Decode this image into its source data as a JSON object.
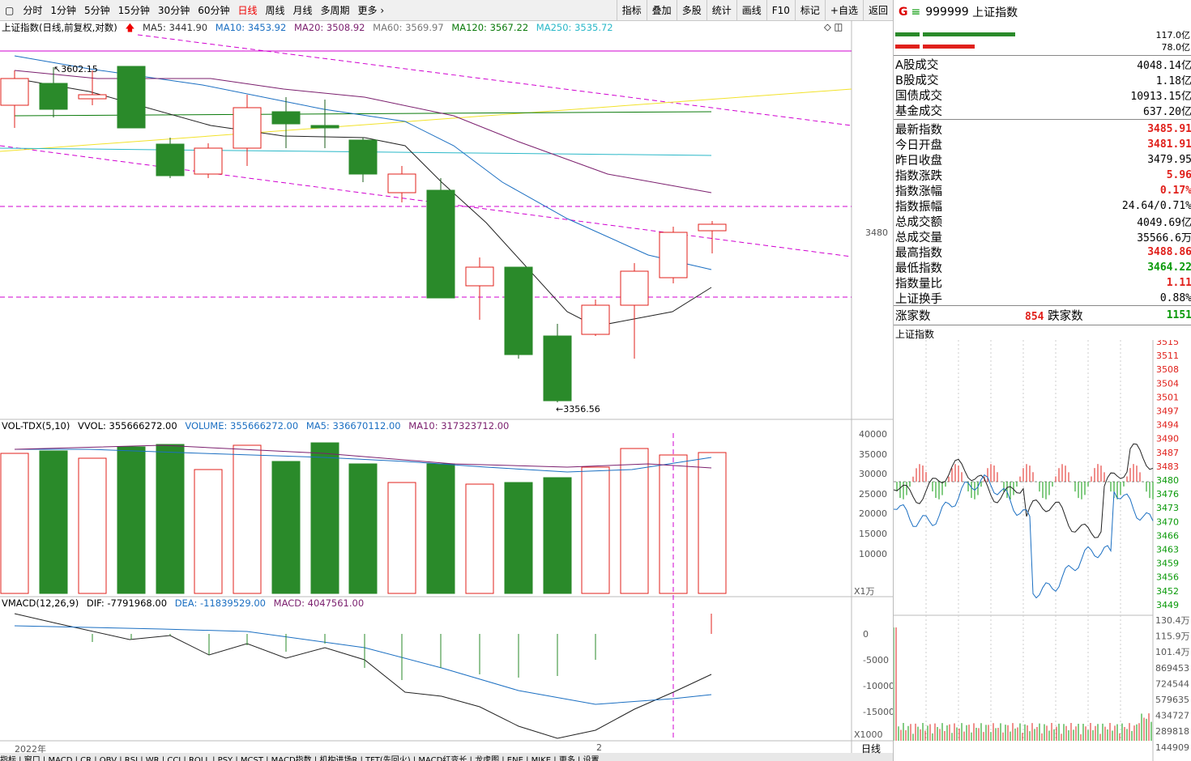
{
  "toolbar": {
    "periods": [
      "分时",
      "1分钟",
      "5分钟",
      "15分钟",
      "30分钟",
      "60分钟",
      "日线",
      "周线",
      "月线",
      "多周期",
      "更多"
    ],
    "active_index": 6,
    "right_buttons": [
      "指标",
      "叠加",
      "多股",
      "统计",
      "画线",
      "F10",
      "标记",
      "+自选",
      "返回"
    ]
  },
  "main_legend": {
    "name": "上证指数(日线,前复权,对数)",
    "ma5": "MA5: 3441.90",
    "ma10": "MA10: 3453.92",
    "ma20": "MA20: 3508.92",
    "ma60": "MA60: 3569.97",
    "ma120": "MA120: 3567.22",
    "ma250": "MA250: 3535.72"
  },
  "annotations": {
    "high": "3602.15",
    "low": "3356.56",
    "price_label": "3480",
    "year": "2022年",
    "month": "2"
  },
  "vol_legend": {
    "name": "VOL-TDX(5,10)",
    "vvol": "VVOL: 355666272.00",
    "volume": "VOLUME: 355666272.00",
    "ma5": "MA5: 336670112.00",
    "ma10": "MA10: 317323712.00"
  },
  "vol_axis": [
    "40000",
    "35000",
    "30000",
    "25000",
    "20000",
    "15000",
    "10000"
  ],
  "vol_unit": "X1万",
  "macd_legend": {
    "name": "VMACD(12,26,9)",
    "dif": "DIF: -7791968.00",
    "dea": "DEA: -11839529.00",
    "macd": "MACD: 4047561.00"
  },
  "macd_axis": [
    "0",
    "-5000",
    "-10000",
    "-15000"
  ],
  "macd_unit": "X1000",
  "bottom_tabs": "指标 | 窗口 | MACD | CR | OBV | RSI | WR | CCI | ROLL | PSY | MCST | MACD指数 | 机构进场R | TFT(先回火) | MACD红变长 | 龙虎图 | ENE | MIKE | 更多 | 设置",
  "quote": {
    "code": "999999",
    "name": "上证指数",
    "bar_vals": [
      "117.0亿",
      "78.0亿"
    ],
    "rows": [
      {
        "label": "A股成交",
        "value": "4048.14亿",
        "color": "black"
      },
      {
        "label": "B股成交",
        "value": "1.18亿",
        "color": "black"
      },
      {
        "label": "国债成交",
        "value": "10913.15亿",
        "color": "black"
      },
      {
        "label": "基金成交",
        "value": "637.20亿",
        "color": "black"
      },
      {
        "label": "最新指数",
        "value": "3485.91",
        "color": "red"
      },
      {
        "label": "今日开盘",
        "value": "3481.91",
        "color": "red"
      },
      {
        "label": "昨日收盘",
        "value": "3479.95",
        "color": "black"
      },
      {
        "label": "指数涨跌",
        "value": "5.96",
        "color": "red"
      },
      {
        "label": "指数涨幅",
        "value": "0.17%",
        "color": "red"
      },
      {
        "label": "指数振幅",
        "value": "24.64/0.71%",
        "color": "black"
      },
      {
        "label": "总成交额",
        "value": "4049.69亿",
        "color": "black"
      },
      {
        "label": "总成交量",
        "value": "35566.6万",
        "color": "black"
      },
      {
        "label": "最高指数",
        "value": "3488.86",
        "color": "red"
      },
      {
        "label": "最低指数",
        "value": "3464.22",
        "color": "green"
      },
      {
        "label": "指数量比",
        "value": "1.11",
        "color": "red"
      },
      {
        "label": "上证换手",
        "value": "0.88%",
        "color": "black"
      }
    ],
    "up_label": "涨家数",
    "up_count": "854",
    "down_label": "跌家数",
    "down_count": "1151"
  },
  "mini": {
    "title": "上证指数",
    "price_axis": [
      "3515",
      "3511",
      "3508",
      "3504",
      "3501",
      "3497",
      "3494",
      "3490",
      "3487",
      "3483",
      "3480",
      "3476",
      "3473",
      "3470",
      "3466",
      "3463",
      "3459",
      "3456",
      "3452",
      "3449"
    ],
    "vol_axis": [
      "130.4万",
      "115.9万",
      "101.4万",
      "869453",
      "724544",
      "579635",
      "434727",
      "289818",
      "144909"
    ],
    "footer": "日线"
  }
}
